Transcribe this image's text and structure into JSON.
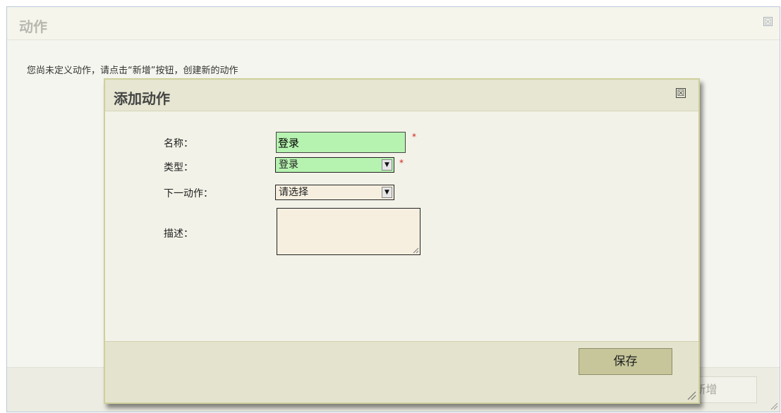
{
  "outer_dialog": {
    "title": "动作",
    "close_glyph": "☒",
    "message": "您尚未定义动作，请点击“新增”按钮，创建新的动作",
    "new_button_label": "新增"
  },
  "add_dialog": {
    "title": "添加动作",
    "close_glyph": "☒",
    "fields": {
      "name_label": "名称：",
      "name_value": "登录",
      "type_label": "类型：",
      "type_selected": "登录",
      "next_action_label": "下一动作：",
      "next_action_selected": "请选择",
      "description_label": "描述：",
      "description_value": ""
    },
    "required_marker": "*",
    "save_button_label": "保存"
  },
  "icons": {
    "close": "close-icon",
    "dropdown": "chevron-down-icon",
    "resize": "resize-grip-icon"
  },
  "colors": {
    "required_field_bg": "#b6f3b0",
    "optional_field_bg": "#f6efe0",
    "required_marker": "#d02020",
    "save_button_bg": "#c6c69a"
  }
}
